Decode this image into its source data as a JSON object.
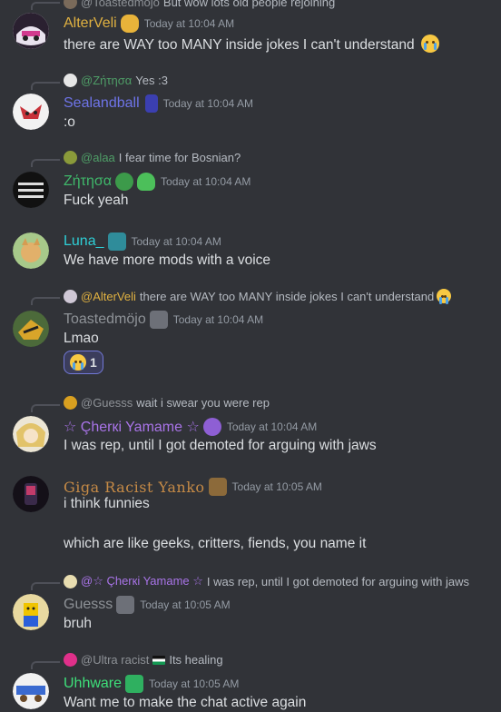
{
  "messages": [
    {
      "reply": {
        "name": "@Toastedmöjo",
        "text": "But wow lots old people rejoining",
        "name_color": "#8e9297"
      },
      "username": "AlterVeli",
      "name_color": "#e0b141",
      "timestamp": "Today at 10:04 AM",
      "lines": [
        "there are WAY too MANY inside jokes I can't understand"
      ],
      "trailing_emoji": "crying-face"
    },
    {
      "reply": {
        "name": "@Ζήτησα",
        "text": "Yes :3",
        "name_color": "#4f9e67"
      },
      "username": "Sealandball",
      "name_color": "#6e74e8",
      "timestamp": "Today at 10:04 AM",
      "lines": [
        ":o"
      ]
    },
    {
      "reply": {
        "name": "@alaa",
        "text": "I fear time for Bosnian?",
        "name_color": "#4f9e67"
      },
      "username": "Ζήτησα",
      "name_color": "#3fb86a",
      "timestamp": "Today at 10:04 AM",
      "lines": [
        "Fuck yeah"
      ]
    },
    {
      "username": "Luna_",
      "name_color": "#2ecfd6",
      "timestamp": "Today at 10:04 AM",
      "lines": [
        "We have more mods with a voice"
      ]
    },
    {
      "reply": {
        "name": "@AlterVeli",
        "text": "there are WAY too MANY inside jokes I can't understand",
        "name_color": "#e0b141"
      },
      "username": "Toastedmöjo",
      "name_color": "#8e9297",
      "timestamp": "Today at 10:04 AM",
      "lines": [
        "Lmao"
      ],
      "reaction": {
        "emoji": "crying-face",
        "count": "1"
      }
    },
    {
      "reply": {
        "name": "@Guesss",
        "text": "wait i swear you were rep",
        "name_color": "#8e9297"
      },
      "username": "☆ Çherкi Yamame ☆",
      "name_color": "#a974e8",
      "timestamp": "Today at 10:04 AM",
      "lines": [
        "I was rep, until I got demoted for arguing with jaws"
      ]
    },
    {
      "username": "Giga Racist Yanko",
      "name_color": "#c58a46",
      "timestamp": "Today at 10:05 AM",
      "lines": [
        "i think funnies",
        "",
        "which are like geeks, critters, fiends, you name it"
      ]
    },
    {
      "reply": {
        "name": "@☆ Çherкi Yamame ☆",
        "text": "I was rep, until I got demoted for arguing with jaws",
        "name_color": "#a974e8"
      },
      "username": "Guesss",
      "name_color": "#8e9297",
      "timestamp": "Today at 10:05 AM",
      "lines": [
        "bruh"
      ]
    },
    {
      "reply": {
        "name": "@Ultra racist",
        "text": "Its healing",
        "name_color": "#8e9297"
      },
      "username": "Uhhware",
      "name_color": "#3ee07a",
      "timestamp": "Today at 10:05 AM",
      "lines": [
        "Want me to make the chat active again"
      ]
    }
  ]
}
